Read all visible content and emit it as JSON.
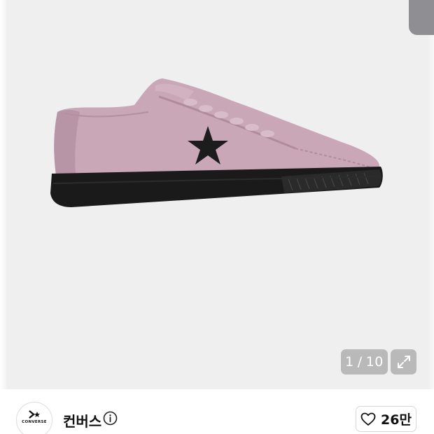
{
  "gallery": {
    "image_alt": "",
    "counter": {
      "current": "1",
      "separator": "/",
      "total": "10"
    },
    "icons": {
      "expand": "expand-arrows-icon"
    }
  },
  "brand": {
    "logo_text": "CONVERSE",
    "name": "컨버스",
    "icons": {
      "info": "info-circle-icon",
      "logo": "converse-chevron-star-icon"
    }
  },
  "like": {
    "count": "26만",
    "icon": "heart-outline-icon"
  },
  "colors": {
    "gallery_bg": "#efefef",
    "shoe_suede": "#c9a7b6",
    "sole": "#1a1a1a",
    "overlay": "#8c8c8c"
  }
}
